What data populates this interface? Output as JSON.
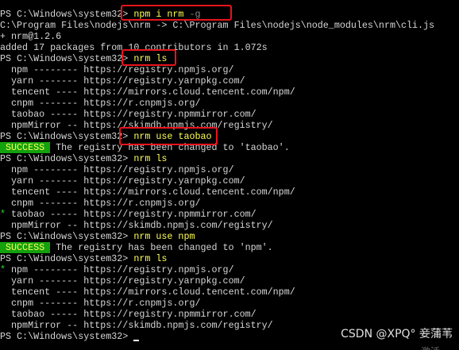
{
  "terminal": {
    "prompt": "PS C:\\Windows\\system32> ",
    "install": {
      "cmd": "npm i nrm",
      "flag": " -g",
      "out1": "C:\\Program Files\\nodejs\\nrm -> C:\\Program Files\\nodejs\\node_modules\\nrm\\cli.js",
      "out2": "+ nrm@1.2.6",
      "out3": "added 17 packages from 10 contributors in 1.072s"
    },
    "ls1": {
      "cmd": "nrm ls",
      "rows": [
        "  npm -------- https://registry.npmjs.org/",
        "  yarn ------- https://registry.yarnpkg.com/",
        "  tencent ---- https://mirrors.cloud.tencent.com/npm/",
        "  cnpm ------- https://r.cnpmjs.org/",
        "  taobao ----- https://registry.npmmirror.com/",
        "  npmMirror -- https://skimdb.npmjs.com/registry/"
      ]
    },
    "use_taobao": {
      "cmd": "nrm use taobao",
      "success_label": " SUCCESS ",
      "message": " The registry has been changed to 'taobao'."
    },
    "ls2": {
      "cmd": "nrm ls",
      "rows": [
        {
          "marker": "  ",
          "text": "npm -------- https://registry.npmjs.org/"
        },
        {
          "marker": "  ",
          "text": "yarn ------- https://registry.yarnpkg.com/"
        },
        {
          "marker": "  ",
          "text": "tencent ---- https://mirrors.cloud.tencent.com/npm/"
        },
        {
          "marker": "  ",
          "text": "cnpm ------- https://r.cnpmjs.org/"
        },
        {
          "marker": "* ",
          "text": "taobao ----- https://registry.npmmirror.com/"
        },
        {
          "marker": "  ",
          "text": "npmMirror -- https://skimdb.npmjs.com/registry/"
        }
      ]
    },
    "use_npm": {
      "cmd": "nrm use npm",
      "success_label": " SUCCESS ",
      "message": " The registry has been changed to 'npm'."
    },
    "ls3": {
      "cmd": "nrm ls",
      "rows": [
        {
          "marker": "* ",
          "text": "npm -------- https://registry.npmjs.org/"
        },
        {
          "marker": "  ",
          "text": "yarn ------- https://registry.yarnpkg.com/"
        },
        {
          "marker": "  ",
          "text": "tencent ---- https://mirrors.cloud.tencent.com/npm/"
        },
        {
          "marker": "  ",
          "text": "cnpm ------- https://r.cnpmjs.org/"
        },
        {
          "marker": "  ",
          "text": "taobao ----- https://registry.npmmirror.com/"
        },
        {
          "marker": "  ",
          "text": "npmMirror -- https://skimdb.npmjs.com/registry/"
        }
      ]
    }
  },
  "watermark": "CSDN @XPQ° 妾蒲苇",
  "ghost_text": "激活"
}
